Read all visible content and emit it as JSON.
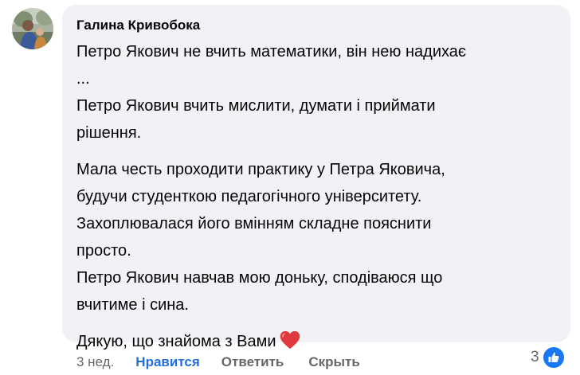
{
  "comment": {
    "author": "Галина Кривобока",
    "paragraphs": [
      {
        "lines": [
          "Петро Якович не вчить математики, він нею надихає",
          "...",
          "Петро Якович вчить мислити, думати і приймати",
          "рішення."
        ]
      },
      {
        "lines": [
          "Мала честь проходити практику у Петра Яковича,",
          "будучи студенткою педагогічного університету.",
          "Захоплювалася його вмінням складне пояснити",
          "просто.",
          "Петро Якович навчав мою доньку, сподіваюся що",
          "вчитиме і сина."
        ]
      },
      {
        "lines": [
          "Дякую, що знайома з Вами"
        ]
      }
    ],
    "closing_emoji": "red-heart-icon"
  },
  "actions": {
    "time": "3 нед.",
    "like_label": "Нравится",
    "reply_label": "Ответить",
    "hide_label": "Скрыть"
  },
  "reactions": {
    "count": "3",
    "icon": "thumbs-up-icon"
  },
  "colors": {
    "bubble_bg": "#f0f2f5",
    "like_active": "#216fdb",
    "muted": "#65676b",
    "reaction_blue": "#1877f2",
    "heart_red": "#e0393e"
  }
}
